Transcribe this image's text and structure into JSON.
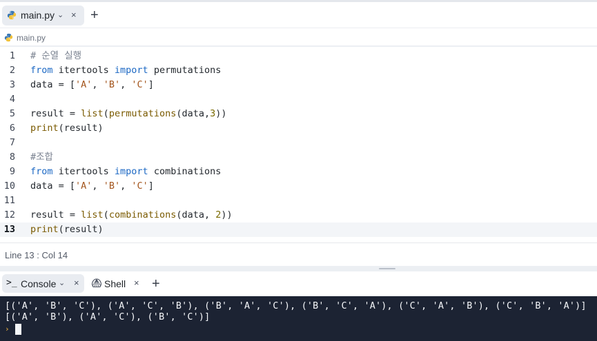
{
  "editor_tab": {
    "filename": "main.py",
    "chevron": "⌄",
    "close": "×"
  },
  "add_tab": "+",
  "breadcrumb": {
    "file": "main.py"
  },
  "code_lines": [
    {
      "num": "1",
      "tokens": [
        {
          "t": "# 순열 실행",
          "k": "comment"
        }
      ]
    },
    {
      "num": "2",
      "tokens": [
        {
          "t": "from",
          "k": "keyword"
        },
        {
          "t": " itertools ",
          "k": "plain"
        },
        {
          "t": "import",
          "k": "keyword"
        },
        {
          "t": " permutations",
          "k": "plain"
        }
      ]
    },
    {
      "num": "3",
      "tokens": [
        {
          "t": "data = [",
          "k": "plain"
        },
        {
          "t": "'A'",
          "k": "string"
        },
        {
          "t": ", ",
          "k": "plain"
        },
        {
          "t": "'B'",
          "k": "string"
        },
        {
          "t": ", ",
          "k": "plain"
        },
        {
          "t": "'C'",
          "k": "string"
        },
        {
          "t": "]",
          "k": "plain"
        }
      ]
    },
    {
      "num": "4",
      "tokens": []
    },
    {
      "num": "5",
      "tokens": [
        {
          "t": "result = ",
          "k": "plain"
        },
        {
          "t": "list",
          "k": "func"
        },
        {
          "t": "(",
          "k": "plain"
        },
        {
          "t": "permutations",
          "k": "func"
        },
        {
          "t": "(data,",
          "k": "plain"
        },
        {
          "t": "3",
          "k": "number"
        },
        {
          "t": "))",
          "k": "plain"
        }
      ]
    },
    {
      "num": "6",
      "tokens": [
        {
          "t": "print",
          "k": "func"
        },
        {
          "t": "(result)",
          "k": "plain"
        }
      ]
    },
    {
      "num": "7",
      "tokens": []
    },
    {
      "num": "8",
      "tokens": [
        {
          "t": "#조합",
          "k": "comment"
        }
      ]
    },
    {
      "num": "9",
      "tokens": [
        {
          "t": "from",
          "k": "keyword"
        },
        {
          "t": " itertools ",
          "k": "plain"
        },
        {
          "t": "import",
          "k": "keyword"
        },
        {
          "t": " combinations",
          "k": "plain"
        }
      ]
    },
    {
      "num": "10",
      "tokens": [
        {
          "t": "data = [",
          "k": "plain"
        },
        {
          "t": "'A'",
          "k": "string"
        },
        {
          "t": ", ",
          "k": "plain"
        },
        {
          "t": "'B'",
          "k": "string"
        },
        {
          "t": ", ",
          "k": "plain"
        },
        {
          "t": "'C'",
          "k": "string"
        },
        {
          "t": "]",
          "k": "plain"
        }
      ]
    },
    {
      "num": "11",
      "tokens": []
    },
    {
      "num": "12",
      "tokens": [
        {
          "t": "result = ",
          "k": "plain"
        },
        {
          "t": "list",
          "k": "func"
        },
        {
          "t": "(",
          "k": "plain"
        },
        {
          "t": "combinations",
          "k": "func"
        },
        {
          "t": "(data, ",
          "k": "plain"
        },
        {
          "t": "2",
          "k": "number"
        },
        {
          "t": "))",
          "k": "plain"
        }
      ]
    },
    {
      "num": "13",
      "active": true,
      "tokens": [
        {
          "t": "print",
          "k": "func"
        },
        {
          "t": "(result)",
          "k": "plain"
        }
      ]
    }
  ],
  "status": {
    "position": "Line 13 : Col 14"
  },
  "panel_tabs": {
    "console": {
      "icon": ">_",
      "label": "Console",
      "chevron": "⌄",
      "close": "×"
    },
    "shell": {
      "label": "Shell",
      "close": "×"
    },
    "add": "+"
  },
  "console_output": [
    "[('A', 'B', 'C'), ('A', 'C', 'B'), ('B', 'A', 'C'), ('B', 'C', 'A'), ('C', 'A', 'B'), ('C', 'B', 'A')]",
    "[('A', 'B'), ('A', 'C'), ('B', 'C')]"
  ],
  "console_prompt": "›",
  "colors": {
    "keyword": "#1c68c4",
    "string": "#a3551c",
    "comment": "#7a8290",
    "console_bg": "#1c2333",
    "prompt": "#f2b540"
  }
}
